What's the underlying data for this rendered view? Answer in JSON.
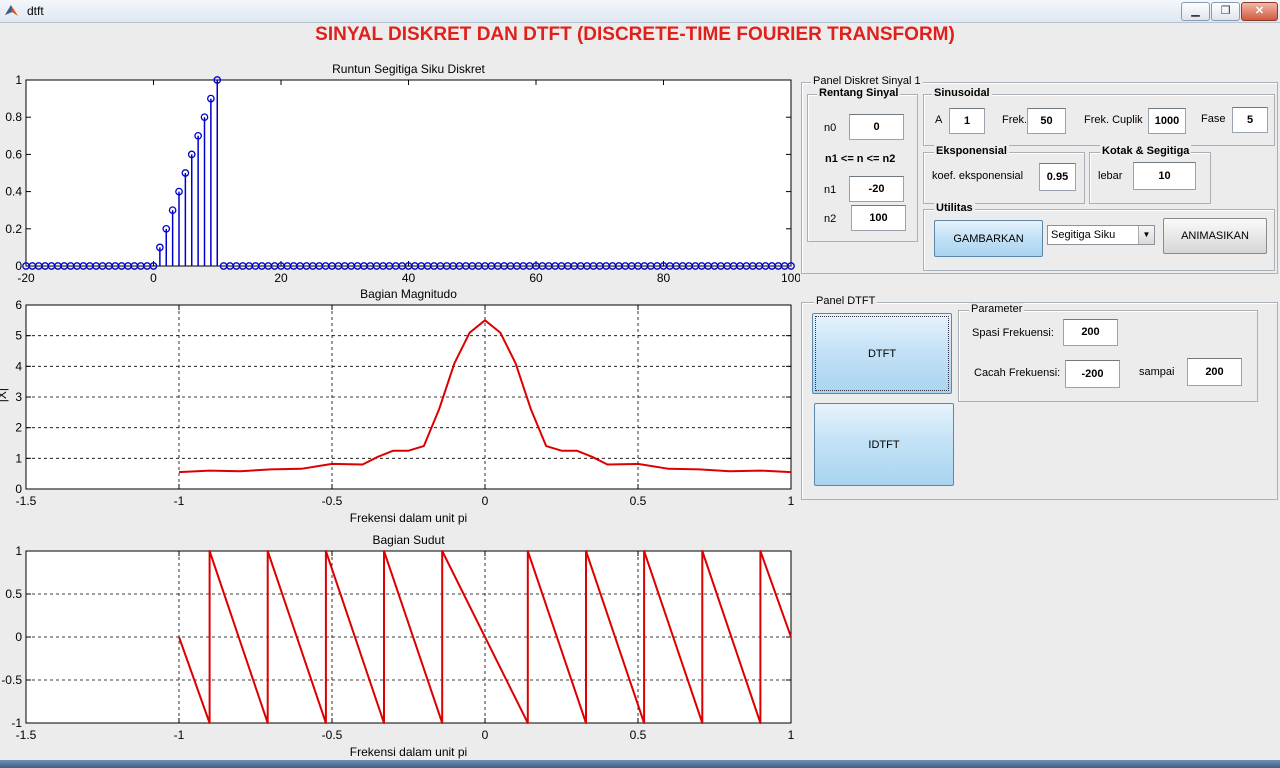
{
  "window": {
    "title": "dtft",
    "minimize": "▁",
    "maximize": "❐",
    "close": "✕"
  },
  "main_title": "SINYAL DISKRET DAN DTFT (DISCRETE-TIME FOURIER TRANSFORM)",
  "chart_data": [
    {
      "type": "stem",
      "title": "Runtun Segitiga Siku Diskret",
      "xlabel": "",
      "ylabel": "",
      "xlim": [
        -20,
        100
      ],
      "ylim": [
        0,
        1
      ],
      "xticks": [
        "-20",
        "0",
        "20",
        "40",
        "60",
        "80",
        "100"
      ],
      "yticks": [
        "0",
        "0.2",
        "0.4",
        "0.6",
        "0.8",
        "1"
      ],
      "x_range": [
        -20,
        100
      ],
      "nonzero_points": {
        "x": [
          1,
          2,
          3,
          4,
          5,
          6,
          7,
          8,
          9,
          10
        ],
        "y": [
          0.1,
          0.2,
          0.3,
          0.4,
          0.5,
          0.6,
          0.7,
          0.8,
          0.9,
          1.0
        ]
      },
      "grid": false,
      "color": "#0000cc"
    },
    {
      "type": "line",
      "title": "Bagian Magnitudo",
      "xlabel": "Frekensi dalam unit pi",
      "ylabel": "|X|",
      "xlim": [
        -1.5,
        1
      ],
      "ylim": [
        0,
        6
      ],
      "xticks": [
        "-1.5",
        "-1",
        "-0.5",
        "0",
        "0.5",
        "1"
      ],
      "yticks": [
        "0",
        "1",
        "2",
        "3",
        "4",
        "5",
        "6"
      ],
      "x": [
        -1,
        -0.9,
        -0.8,
        -0.7,
        -0.6,
        -0.5,
        -0.4,
        -0.35,
        -0.3,
        -0.25,
        -0.2,
        -0.15,
        -0.1,
        -0.05,
        0,
        0.05,
        0.1,
        0.15,
        0.2,
        0.25,
        0.3,
        0.35,
        0.4,
        0.5,
        0.6,
        0.7,
        0.8,
        0.9,
        1
      ],
      "y": [
        0.55,
        0.6,
        0.58,
        0.64,
        0.66,
        0.82,
        0.8,
        1.05,
        1.25,
        1.25,
        1.4,
        2.6,
        4.1,
        5.1,
        5.5,
        5.1,
        4.1,
        2.6,
        1.4,
        1.25,
        1.25,
        1.05,
        0.8,
        0.82,
        0.66,
        0.64,
        0.58,
        0.6,
        0.55
      ],
      "grid": true,
      "color": "#dd0000"
    },
    {
      "type": "line",
      "title": "Bagian Sudut",
      "xlabel": "Frekensi dalam unit pi",
      "ylabel": "",
      "xlim": [
        -1.5,
        1
      ],
      "ylim": [
        -1,
        1
      ],
      "xticks": [
        "-1.5",
        "-1",
        "-0.5",
        "0",
        "0.5",
        "1"
      ],
      "yticks": [
        "-1",
        "-0.5",
        "0",
        "0.5",
        "1"
      ],
      "x": [
        -1,
        -0.9,
        -0.9,
        -0.71,
        -0.71,
        -0.52,
        -0.52,
        -0.33,
        -0.33,
        -0.14,
        -0.14,
        0.14,
        0.14,
        0.33,
        0.33,
        0.52,
        0.52,
        0.71,
        0.71,
        0.9,
        0.9,
        1
      ],
      "y": [
        0,
        -1,
        1,
        -1,
        1,
        -1,
        1,
        -1,
        1,
        -1,
        1,
        -1,
        1,
        -1,
        1,
        -1,
        1,
        -1,
        1,
        -1,
        1,
        0
      ],
      "grid": true,
      "color": "#dd0000"
    }
  ],
  "panel1": {
    "title": "Panel Diskret Sinyal 1",
    "rentang": {
      "title": "Rentang Sinyal",
      "n0_label": "n0",
      "n0": "0",
      "cond": "n1 <= n <= n2",
      "n1_label": "n1",
      "n1": "-20",
      "n2_label": "n2",
      "n2": "100"
    },
    "sinus": {
      "title": "Sinusoidal",
      "a_label": "A",
      "a": "1",
      "frek_label": "Frek.",
      "frek": "50",
      "cuplik_label": "Frek. Cuplik",
      "cuplik": "1000",
      "fase_label": "Fase",
      "fase": "5"
    },
    "eksp": {
      "title": "Eksponensial",
      "koef_label": "koef. eksponensial",
      "koef": "0.95"
    },
    "kotak": {
      "title": "Kotak & Segitiga",
      "lebar_label": "lebar",
      "lebar": "10"
    },
    "util": {
      "title": "Utilitas",
      "gambarkan": "GAMBARKAN",
      "select": "Segitiga Siku",
      "animasikan": "ANIMASIKAN"
    }
  },
  "panel_dtft": {
    "title": "Panel DTFT",
    "dtft": "DTFT",
    "idtft": "IDTFT",
    "param": {
      "title": "Parameter",
      "spasi_label": "Spasi Frekuensi:",
      "spasi": "200",
      "cacah_label": "Cacah Frekuensi:",
      "cacah": "-200",
      "sampai_label": "sampai",
      "sampai": "200"
    }
  }
}
